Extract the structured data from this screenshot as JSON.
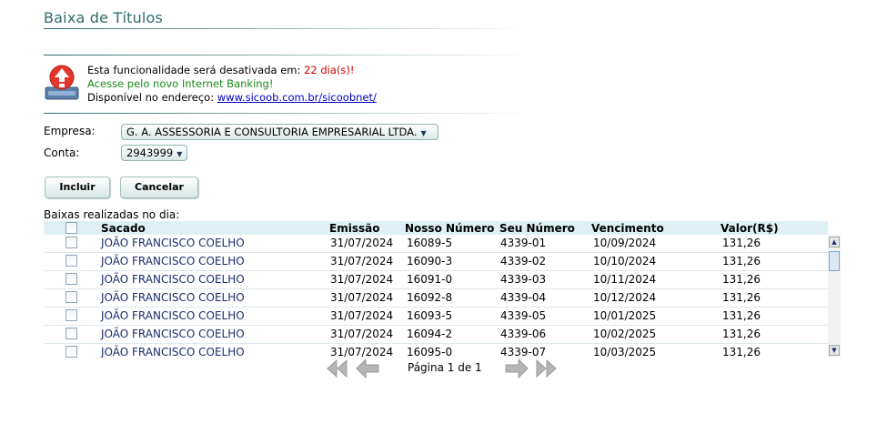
{
  "page": {
    "title": "Baixa de Títulos"
  },
  "notice": {
    "line1_prefix": "Esta funcionalidade será desativada em: ",
    "line1_days": "22 dia(s)!",
    "line2": "Acesse pelo novo Internet Banking!",
    "line3_prefix": "Disponível no endereço: ",
    "line3_link": "www.sicoob.com.br/sicoobnet/",
    "icon": "alert-upload-icon",
    "colors": {
      "days": "#d90000",
      "internet_banking": "#1b8a1b",
      "link": "#0000cc"
    }
  },
  "form": {
    "empresa_label": "Empresa:",
    "empresa_value": "G. A. ASSESSORIA E CONSULTORIA EMPRESARIAL LTDA.",
    "conta_label": "Conta:",
    "conta_value": "2943999"
  },
  "buttons": {
    "incluir": "Incluir",
    "cancelar": "Cancelar"
  },
  "list": {
    "caption": "Baixas realizadas no dia:",
    "columns": {
      "sacado": "Sacado",
      "emissao": "Emissão",
      "nosso_numero": "Nosso Número",
      "seu_numero": "Seu Número",
      "vencimento": "Vencimento",
      "valor": "Valor(R$)"
    },
    "rows": [
      {
        "sacado": "JOÃO FRANCISCO COELHO",
        "emissao": "31/07/2024",
        "nosso_numero": "16089-5",
        "seu_numero": "4339-01",
        "vencimento": "10/09/2024",
        "valor": "131,26"
      },
      {
        "sacado": "JOÃO FRANCISCO COELHO",
        "emissao": "31/07/2024",
        "nosso_numero": "16090-3",
        "seu_numero": "4339-02",
        "vencimento": "10/10/2024",
        "valor": "131,26"
      },
      {
        "sacado": "JOÃO FRANCISCO COELHO",
        "emissao": "31/07/2024",
        "nosso_numero": "16091-0",
        "seu_numero": "4339-03",
        "vencimento": "10/11/2024",
        "valor": "131,26"
      },
      {
        "sacado": "JOÃO FRANCISCO COELHO",
        "emissao": "31/07/2024",
        "nosso_numero": "16092-8",
        "seu_numero": "4339-04",
        "vencimento": "10/12/2024",
        "valor": "131,26"
      },
      {
        "sacado": "JOÃO FRANCISCO COELHO",
        "emissao": "31/07/2024",
        "nosso_numero": "16093-5",
        "seu_numero": "4339-05",
        "vencimento": "10/01/2025",
        "valor": "131,26"
      },
      {
        "sacado": "JOÃO FRANCISCO COELHO",
        "emissao": "31/07/2024",
        "nosso_numero": "16094-2",
        "seu_numero": "4339-06",
        "vencimento": "10/02/2025",
        "valor": "131,26"
      },
      {
        "sacado": "JOÃO FRANCISCO COELHO",
        "emissao": "31/07/2024",
        "nosso_numero": "16095-0",
        "seu_numero": "4339-07",
        "vencimento": "10/03/2025",
        "valor": "131,26"
      }
    ]
  },
  "pager": {
    "text": "Página 1 de 1",
    "icons": [
      "first-page-icon",
      "previous-page-icon",
      "next-page-icon",
      "last-page-icon"
    ]
  }
}
